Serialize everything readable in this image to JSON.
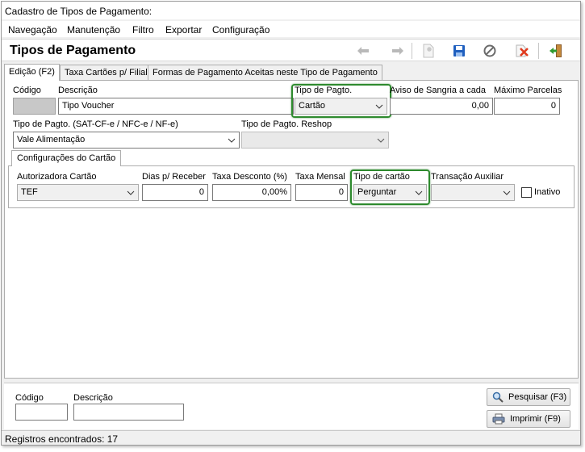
{
  "window": {
    "title": "Cadastro de Tipos de Pagamento:"
  },
  "menu": {
    "items": [
      "Navegação",
      "Manutenção",
      "Filtro",
      "Exportar",
      "Configuração"
    ]
  },
  "toolbar": {
    "title": "Tipos de Pagamento",
    "icons": [
      "arrow-left-icon",
      "arrow-right-icon",
      "new-record-icon",
      "save-icon",
      "cancel-icon",
      "delete-icon",
      "exit-icon"
    ]
  },
  "tabs": [
    "Edição (F2)",
    "Taxa Cartões p/ Filial",
    "Formas de Pagamento Aceitas neste Tipo de Pagamento"
  ],
  "form": {
    "codigo_label": "Código",
    "codigo_value": "",
    "descricao_label": "Descrição",
    "descricao_value": "Tipo Voucher",
    "tipo_pagto_label": "Tipo de Pagto.",
    "tipo_pagto_value": "Cartão",
    "aviso_label": "Aviso de Sangria a cada",
    "aviso_value": "0,00",
    "max_parcelas_label": "Máximo Parcelas",
    "max_parcelas_value": "0",
    "sat_label": "Tipo de Pagto. (SAT-CF-e / NFC-e / NF-e)",
    "sat_value": "Vale Alimentação",
    "reshop_label": "Tipo de Pagto. Reshop",
    "reshop_value": ""
  },
  "card_config": {
    "tab_label": "Configurações do Cartão",
    "autorizadora_label": "Autorizadora Cartão",
    "autorizadora_value": "TEF",
    "dias_label": "Dias p/ Receber",
    "dias_value": "0",
    "taxa_desc_label": "Taxa Desconto (%)",
    "taxa_desc_value": "0,00%",
    "taxa_mensal_label": "Taxa Mensal",
    "taxa_mensal_value": "0",
    "tipo_cartao_label": "Tipo de cartão",
    "tipo_cartao_value": "Perguntar",
    "transacao_label": "Transação Auxiliar",
    "transacao_value": "",
    "inativo_label": "Inativo"
  },
  "search": {
    "codigo_label": "Código",
    "descricao_label": "Descrição",
    "pesquisar_label": "Pesquisar (F3)",
    "imprimir_label": "Imprimir (F9)"
  },
  "status": {
    "text": "Registros encontrados: 17"
  },
  "colors": {
    "highlight": "#2e8a2e",
    "save_blue": "#1f5fbf",
    "delete_red": "#e03a1e"
  }
}
